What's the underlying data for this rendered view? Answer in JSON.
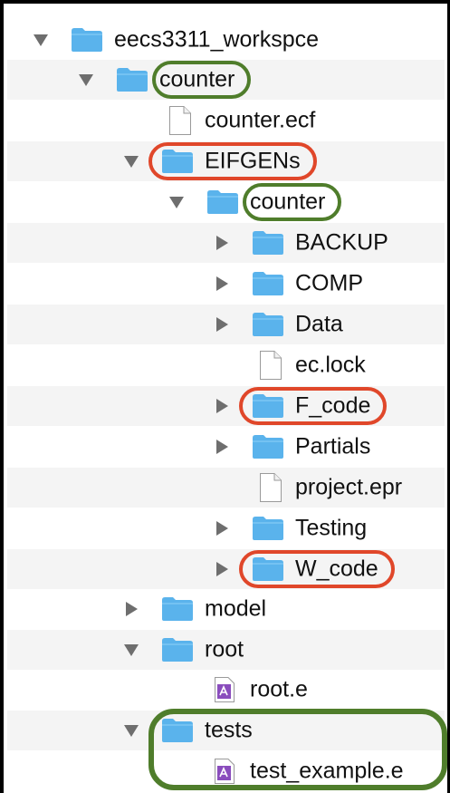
{
  "tree": {
    "items": [
      {
        "id": "eecs3311-workspace",
        "label": "eecs3311_workspce",
        "type": "folder",
        "depth": 0,
        "expanded": true
      },
      {
        "id": "counter",
        "label": "counter",
        "type": "folder",
        "depth": 1,
        "expanded": true
      },
      {
        "id": "counter-ecf",
        "label": "counter.ecf",
        "type": "file",
        "depth": 2
      },
      {
        "id": "eifgens",
        "label": "EIFGENs",
        "type": "folder",
        "depth": 2,
        "expanded": true
      },
      {
        "id": "eifgens-counter",
        "label": "counter",
        "type": "folder",
        "depth": 3,
        "expanded": true
      },
      {
        "id": "backup",
        "label": "BACKUP",
        "type": "folder",
        "depth": 4,
        "expanded": false
      },
      {
        "id": "comp",
        "label": "COMP",
        "type": "folder",
        "depth": 4,
        "expanded": false
      },
      {
        "id": "data",
        "label": "Data",
        "type": "folder",
        "depth": 4,
        "expanded": false
      },
      {
        "id": "ec-lock",
        "label": "ec.lock",
        "type": "file",
        "depth": 4
      },
      {
        "id": "f-code",
        "label": "F_code",
        "type": "folder",
        "depth": 4,
        "expanded": false
      },
      {
        "id": "partials",
        "label": "Partials",
        "type": "folder",
        "depth": 4,
        "expanded": false
      },
      {
        "id": "project-epr",
        "label": "project.epr",
        "type": "file",
        "depth": 4
      },
      {
        "id": "testing",
        "label": "Testing",
        "type": "folder",
        "depth": 4,
        "expanded": false
      },
      {
        "id": "w-code",
        "label": "W_code",
        "type": "folder",
        "depth": 4,
        "expanded": false
      },
      {
        "id": "model",
        "label": "model",
        "type": "folder",
        "depth": 2,
        "expanded": false
      },
      {
        "id": "root",
        "label": "root",
        "type": "folder",
        "depth": 2,
        "expanded": true
      },
      {
        "id": "root-e",
        "label": "root.e",
        "type": "eiffel-file",
        "depth": 3
      },
      {
        "id": "tests",
        "label": "tests",
        "type": "folder",
        "depth": 2,
        "expanded": true
      },
      {
        "id": "test-example-e",
        "label": "test_example.e",
        "type": "eiffel-file",
        "depth": 3
      }
    ]
  },
  "highlights": [
    {
      "target": "counter",
      "color": "green"
    },
    {
      "target": "eifgens",
      "color": "red"
    },
    {
      "target": "eifgens-counter",
      "color": "green"
    },
    {
      "target": "f-code",
      "color": "red"
    },
    {
      "target": "w-code",
      "color": "red"
    },
    {
      "target": "tests-group",
      "color": "green"
    }
  ],
  "colors": {
    "folder": "#5ab3ec",
    "folder_tab": "#7cc7f3",
    "arrow": "#6e6e6e",
    "highlight_green": "#4f7d2b",
    "highlight_red": "#e0472a",
    "eiffel_icon": "#8a4dbd"
  },
  "icons": {
    "folder": "folder-icon",
    "file": "document-icon",
    "eiffel-file": "eiffel-file-icon",
    "expanded": "triangle-down-icon",
    "collapsed": "triangle-right-icon"
  }
}
